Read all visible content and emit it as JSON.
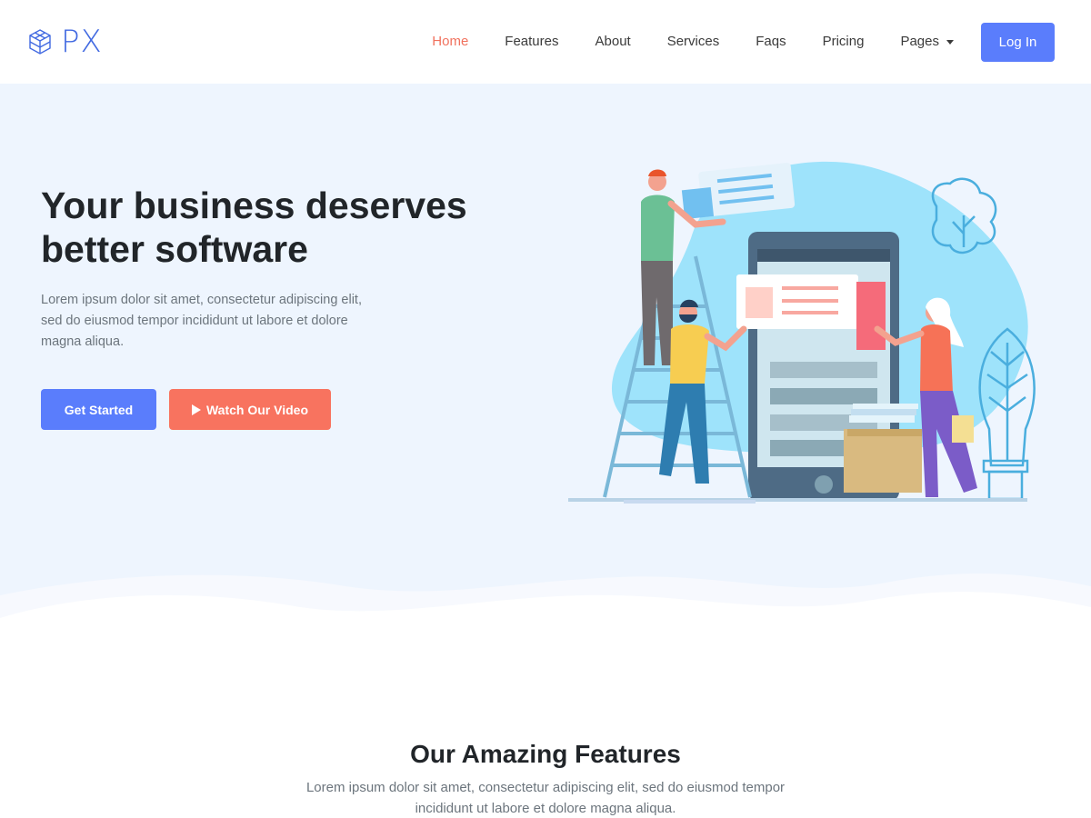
{
  "brand": {
    "name": "PX",
    "accent": "#5a7dfc",
    "secondary": "#f8735f",
    "logo_icon": "cube-icon"
  },
  "nav": {
    "items": [
      {
        "label": "Home",
        "active": true
      },
      {
        "label": "Features"
      },
      {
        "label": "About"
      },
      {
        "label": "Services"
      },
      {
        "label": "Faqs"
      },
      {
        "label": "Pricing"
      },
      {
        "label": "Pages",
        "dropdown": true
      }
    ],
    "login_label": "Log In"
  },
  "hero": {
    "title": "Your business deserves better software",
    "text": "Lorem ipsum dolor sit amet, consectetur adipiscing elit, sed do eiusmod tempor incididunt ut labore et dolore magna aliqua.",
    "primary_button": "Get Started",
    "secondary_button": "Watch Our Video",
    "secondary_icon": "play-icon",
    "illustration": "team-building-app-illustration"
  },
  "features": {
    "title": "Our Amazing Features",
    "text": "Lorem ipsum dolor sit amet, consectetur adipiscing elit, sed do eiusmod tempor incididunt ut labore et dolore magna aliqua."
  }
}
